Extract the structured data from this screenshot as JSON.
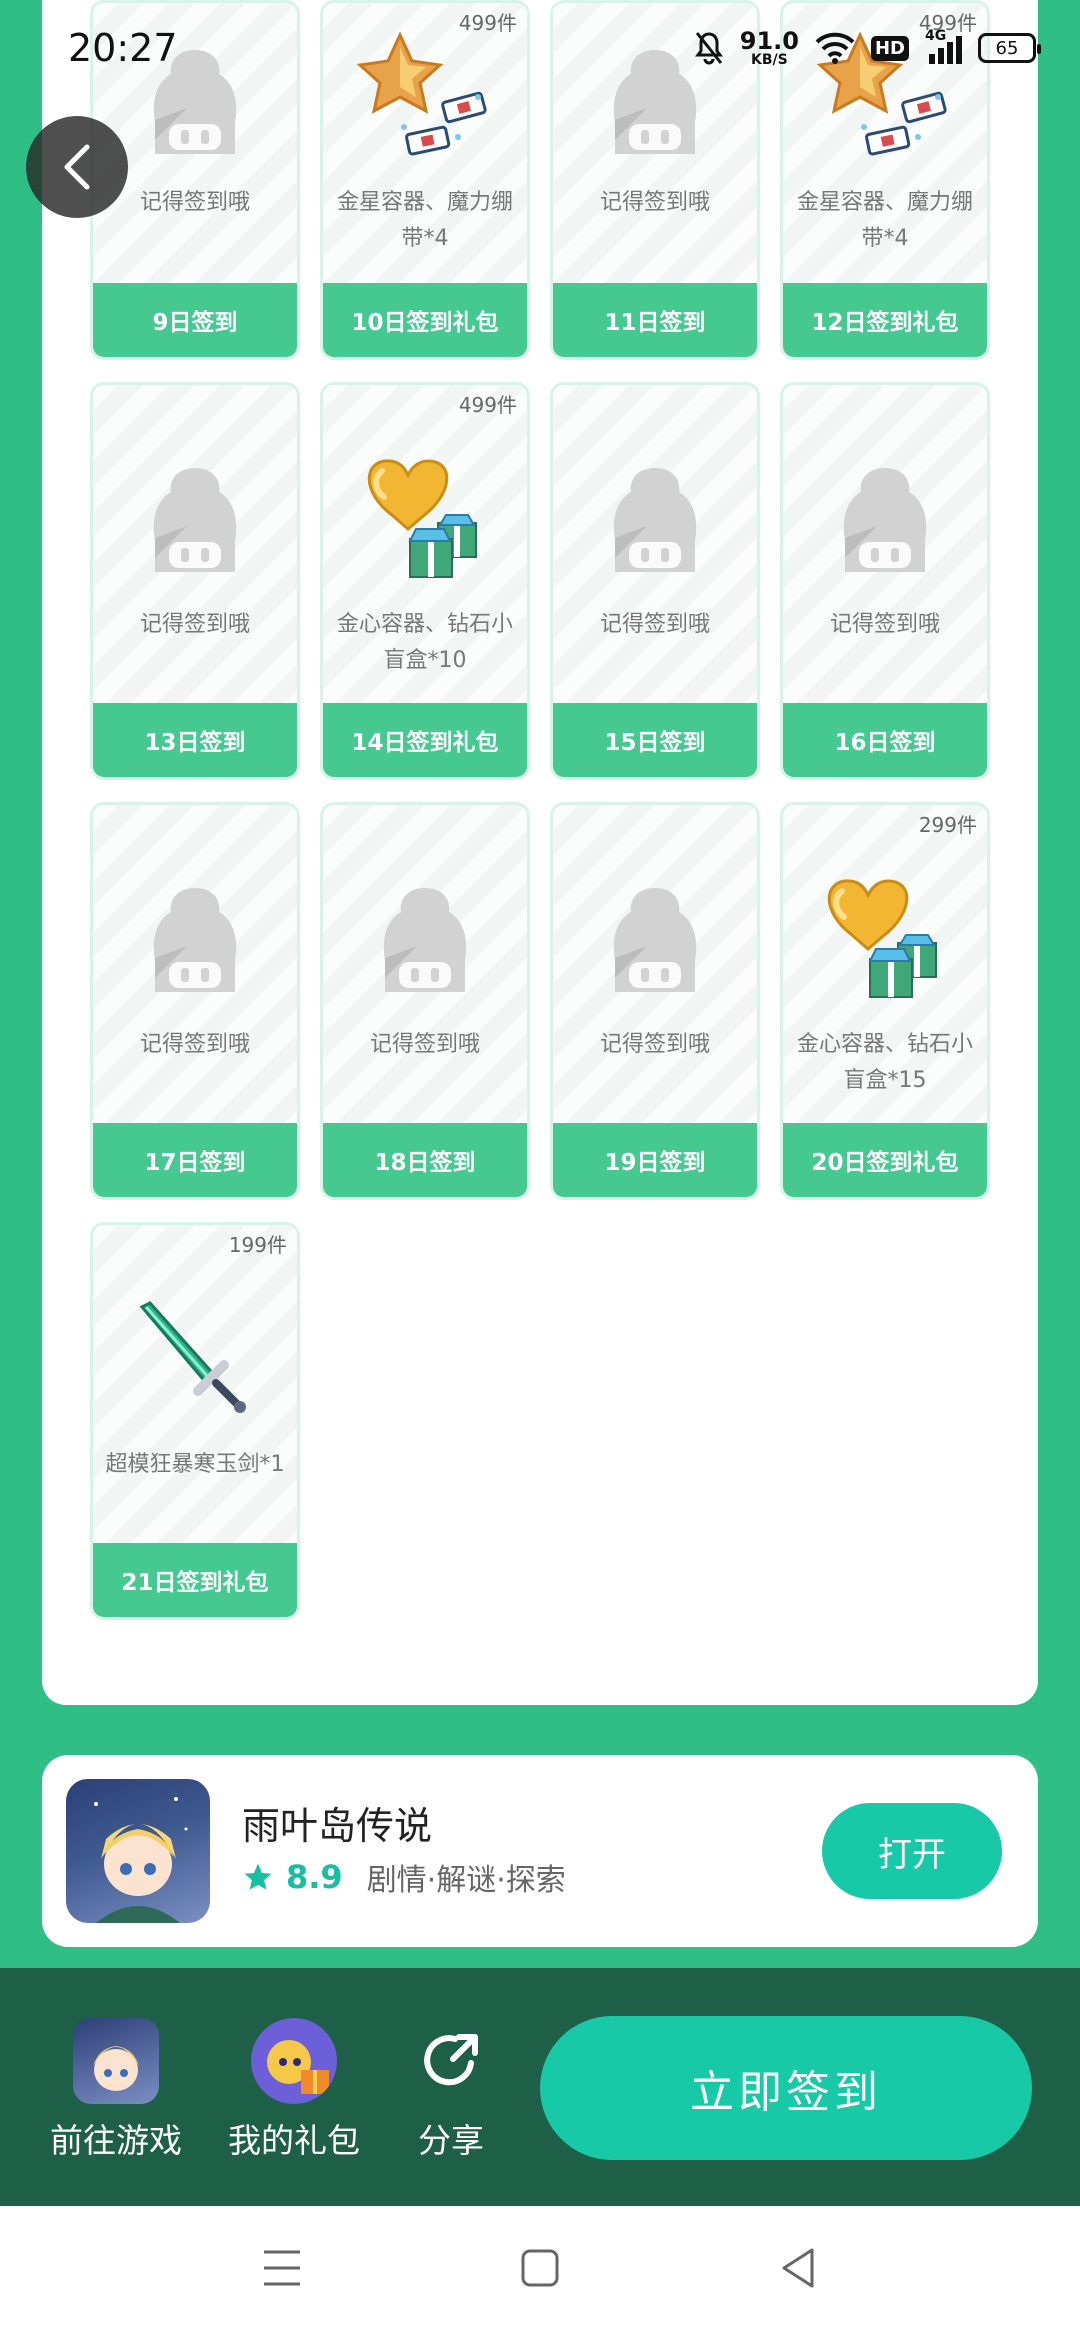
{
  "status_bar": {
    "time": "20:27",
    "net_speed_value": "91.0",
    "net_speed_unit": "KB/S",
    "hd_label": "HD",
    "signal_label": "4G",
    "battery": "65"
  },
  "cards": [
    {
      "day_label": "9日签到",
      "desc": "记得签到哦",
      "count": "",
      "type": "placeholder"
    },
    {
      "day_label": "10日签到礼包",
      "desc": "金星容器、魔力绷带*4",
      "count": "499件",
      "type": "star-bandage"
    },
    {
      "day_label": "11日签到",
      "desc": "记得签到哦",
      "count": "",
      "type": "placeholder"
    },
    {
      "day_label": "12日签到礼包",
      "desc": "金星容器、魔力绷带*4",
      "count": "499件",
      "type": "star-bandage"
    },
    {
      "day_label": "13日签到",
      "desc": "记得签到哦",
      "count": "",
      "type": "placeholder"
    },
    {
      "day_label": "14日签到礼包",
      "desc": "金心容器、钻石小盲盒*10",
      "count": "499件",
      "type": "heart-box"
    },
    {
      "day_label": "15日签到",
      "desc": "记得签到哦",
      "count": "",
      "type": "placeholder"
    },
    {
      "day_label": "16日签到",
      "desc": "记得签到哦",
      "count": "",
      "type": "placeholder"
    },
    {
      "day_label": "17日签到",
      "desc": "记得签到哦",
      "count": "",
      "type": "placeholder"
    },
    {
      "day_label": "18日签到",
      "desc": "记得签到哦",
      "count": "",
      "type": "placeholder"
    },
    {
      "day_label": "19日签到",
      "desc": "记得签到哦",
      "count": "",
      "type": "placeholder"
    },
    {
      "day_label": "20日签到礼包",
      "desc": "金心容器、钻石小盲盒*15",
      "count": "299件",
      "type": "heart-box"
    },
    {
      "day_label": "21日签到礼包",
      "desc": "超模狂暴寒玉剑*1",
      "count": "199件",
      "type": "sword"
    }
  ],
  "game": {
    "title": "雨叶岛传说",
    "rating": "8.9",
    "tags": "剧情·解谜·探索",
    "open_label": "打开"
  },
  "actions": {
    "go_game": "前往游戏",
    "my_gifts": "我的礼包",
    "share": "分享",
    "sign_in_now": "立即签到"
  },
  "colors": {
    "background": "#2fbf86",
    "card_footer": "#45c990",
    "accent": "#18c9a8",
    "action_bar": "#1d6047"
  }
}
